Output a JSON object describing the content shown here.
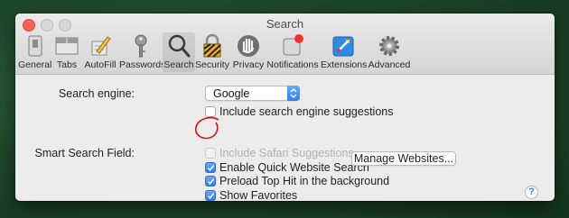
{
  "window": {
    "title": "Search"
  },
  "toolbar": {
    "items": [
      {
        "label": "General",
        "icon": "general-switch-icon"
      },
      {
        "label": "Tabs",
        "icon": "tabs-icon"
      },
      {
        "label": "AutoFill",
        "icon": "autofill-pencil-icon"
      },
      {
        "label": "Passwords",
        "icon": "key-icon"
      },
      {
        "label": "Search",
        "icon": "magnifier-icon",
        "selected": true
      },
      {
        "label": "Security",
        "icon": "lock-icon"
      },
      {
        "label": "Privacy",
        "icon": "hand-icon"
      },
      {
        "label": "Notifications",
        "icon": "notifications-icon"
      },
      {
        "label": "Extensions",
        "icon": "extensions-icon"
      },
      {
        "label": "Advanced",
        "icon": "gear-icon"
      }
    ]
  },
  "search": {
    "engine_label": "Search engine:",
    "engine_value": "Google",
    "suggestions_label": "Include search engine suggestions",
    "suggestions_checked": false
  },
  "smart_field": {
    "label": "Smart Search Field:",
    "options": [
      {
        "label": "Include Safari Suggestions",
        "checked": false,
        "disabled": true
      },
      {
        "label": "Enable Quick Website Search",
        "checked": true,
        "disabled": false
      },
      {
        "label": "Preload Top Hit in the background",
        "checked": true,
        "disabled": false
      },
      {
        "label": "Show Favorites",
        "checked": true,
        "disabled": false
      }
    ],
    "manage_button": "Manage Websites..."
  },
  "help_symbol": "?",
  "colors": {
    "accent": "#2f7ef2",
    "annotation": "#d0121b",
    "close": "#fc5f57"
  }
}
